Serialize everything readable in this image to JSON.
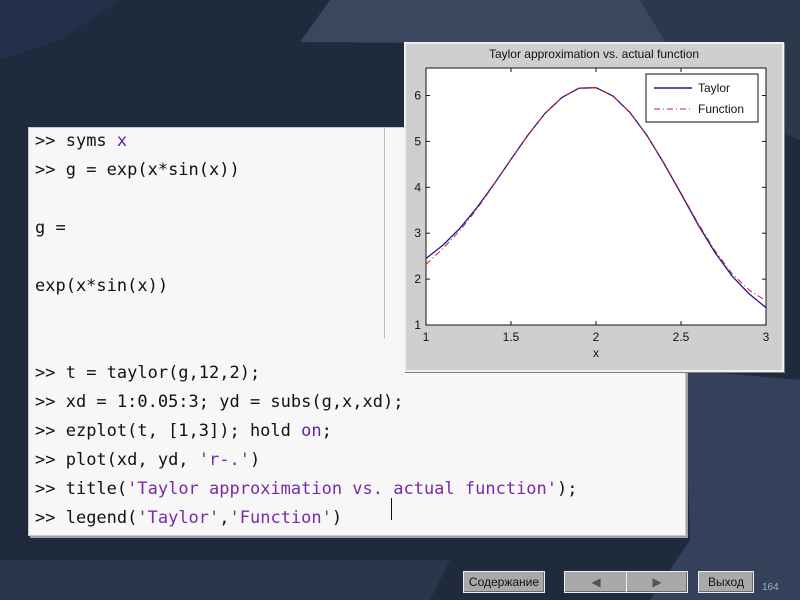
{
  "console": {
    "lines": [
      {
        "prompt": ">> ",
        "segments": [
          {
            "t": "syms ",
            "c": "plain"
          },
          {
            "t": "x",
            "c": "kw"
          }
        ]
      },
      {
        "prompt": ">> ",
        "segments": [
          {
            "t": "g = exp(x*sin(x))",
            "c": "plain"
          }
        ]
      },
      {
        "prompt": "",
        "segments": []
      },
      {
        "prompt": "",
        "segments": [
          {
            "t": "g =",
            "c": "plain"
          }
        ]
      },
      {
        "prompt": "",
        "segments": []
      },
      {
        "prompt": "",
        "segments": [
          {
            "t": "exp(x*sin(x))",
            "c": "plain"
          }
        ]
      },
      {
        "prompt": "",
        "segments": []
      },
      {
        "prompt": "",
        "segments": []
      },
      {
        "prompt": ">> ",
        "segments": [
          {
            "t": "t = taylor(g,12,2);",
            "c": "plain"
          }
        ]
      },
      {
        "prompt": ">> ",
        "segments": [
          {
            "t": "xd = 1:0.05:3; yd = subs(g,x,xd);",
            "c": "plain"
          }
        ]
      },
      {
        "prompt": ">> ",
        "segments": [
          {
            "t": "ezplot(t, [1,3]); hold ",
            "c": "plain"
          },
          {
            "t": "on",
            "c": "kw"
          },
          {
            "t": ";",
            "c": "plain"
          }
        ]
      },
      {
        "prompt": ">> ",
        "segments": [
          {
            "t": "plot(xd, yd, ",
            "c": "plain"
          },
          {
            "t": "'r-.'",
            "c": "str"
          },
          {
            "t": ")",
            "c": "plain"
          }
        ]
      },
      {
        "prompt": ">> ",
        "segments": [
          {
            "t": "title(",
            "c": "plain"
          },
          {
            "t": "'Taylor approximation vs. actual function'",
            "c": "str"
          },
          {
            "t": ");",
            "c": "plain"
          }
        ]
      },
      {
        "prompt": ">> ",
        "segments": [
          {
            "t": "legend(",
            "c": "plain"
          },
          {
            "t": "'Taylor'",
            "c": "str"
          },
          {
            "t": ",",
            "c": "plain"
          },
          {
            "t": "'Function'",
            "c": "str"
          },
          {
            "t": ")",
            "c": "plain"
          }
        ]
      }
    ]
  },
  "figure": {
    "title": "Taylor approximation vs. actual function",
    "xlabel": "x",
    "legend": [
      "Taylor",
      "Function"
    ]
  },
  "chart_data": {
    "type": "line",
    "title": "Taylor approximation vs. actual function",
    "xlabel": "x",
    "ylabel": "",
    "xlim": [
      1,
      3
    ],
    "ylim": [
      1,
      6.6
    ],
    "xticks": [
      "1",
      "1.5",
      "2",
      "2.5",
      "3"
    ],
    "yticks": [
      "1",
      "2",
      "3",
      "4",
      "5",
      "6"
    ],
    "legend_position": "top-right",
    "series": [
      {
        "name": "Taylor",
        "color": "#1a1a8c",
        "style": "solid",
        "x": [
          1.0,
          1.1,
          1.2,
          1.3,
          1.4,
          1.5,
          1.6,
          1.7,
          1.8,
          1.9,
          2.0,
          2.1,
          2.2,
          2.3,
          2.4,
          2.5,
          2.6,
          2.7,
          2.8,
          2.9,
          3.0
        ],
        "y": [
          2.45,
          2.74,
          3.11,
          3.56,
          4.07,
          4.61,
          5.14,
          5.61,
          5.96,
          6.16,
          6.17,
          5.99,
          5.63,
          5.13,
          4.52,
          3.86,
          3.19,
          2.58,
          2.07,
          1.68,
          1.38
        ]
      },
      {
        "name": "Function",
        "color": "#d42020",
        "style": "dashdot",
        "x": [
          1.0,
          1.1,
          1.2,
          1.3,
          1.4,
          1.5,
          1.6,
          1.7,
          1.8,
          1.9,
          2.0,
          2.1,
          2.2,
          2.3,
          2.4,
          2.5,
          2.6,
          2.7,
          2.8,
          2.9,
          3.0
        ],
        "y": [
          2.32,
          2.67,
          3.06,
          3.53,
          4.06,
          4.61,
          5.14,
          5.61,
          5.96,
          6.16,
          6.17,
          5.99,
          5.63,
          5.13,
          4.53,
          3.88,
          3.22,
          2.62,
          2.12,
          1.76,
          1.53
        ]
      }
    ]
  },
  "nav": {
    "contents_label": "Содержание",
    "back_symbol": "◀",
    "forward_symbol": "▶",
    "exit_label": "Выход"
  },
  "page_number": "164",
  "colors": {
    "background": "#1f2a3d",
    "keyword": "#6a1fa8",
    "string": "#7b2aa6",
    "taylor_line": "#1a1a8c",
    "function_line": "#d42020"
  }
}
